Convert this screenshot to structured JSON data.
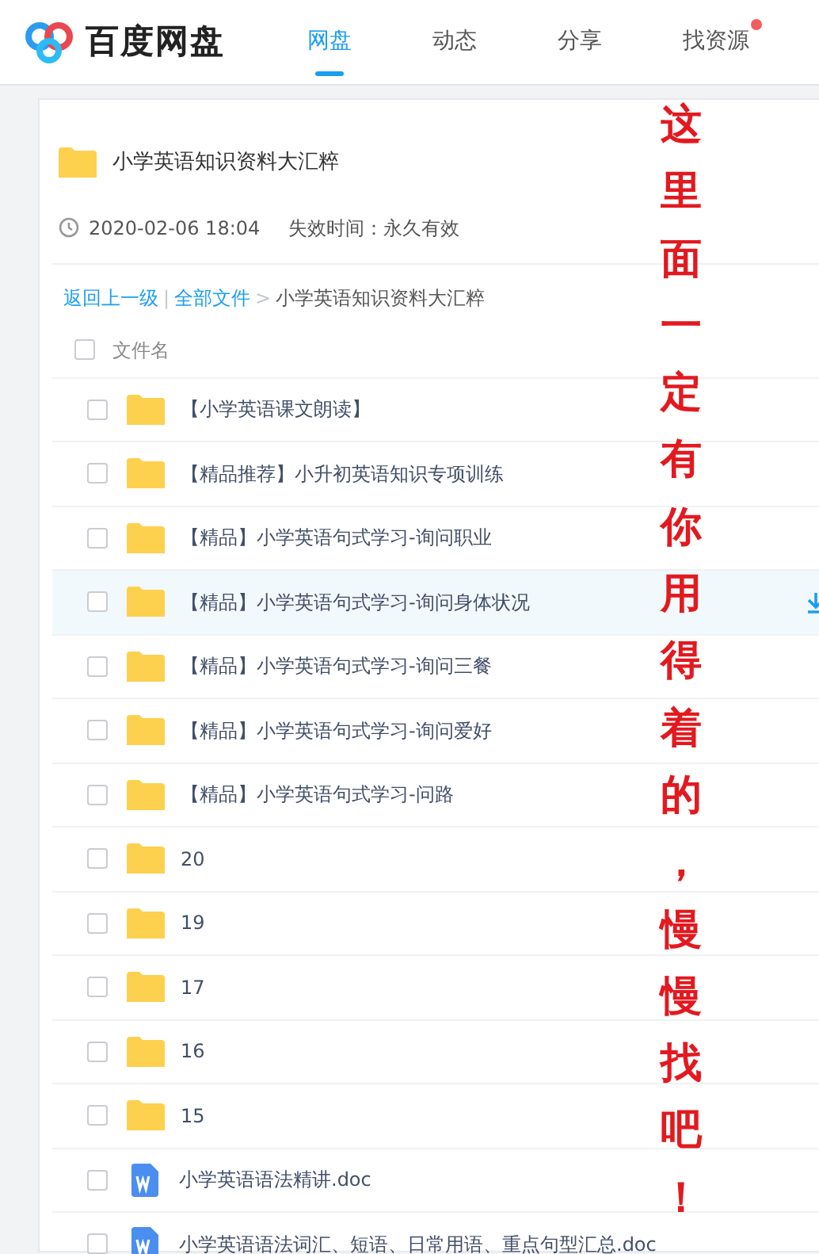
{
  "header": {
    "logo": "百度网盘",
    "tabs": [
      {
        "label": "网盘",
        "selected": true,
        "dot": false
      },
      {
        "label": "动态",
        "selected": false,
        "dot": false
      },
      {
        "label": "分享",
        "selected": false,
        "dot": false
      },
      {
        "label": "找资源",
        "selected": false,
        "dot": true
      }
    ]
  },
  "share": {
    "title": "小学英语知识资料大汇粹",
    "date": "2020-02-06 18:04",
    "expiry": "失效时间：永久有效"
  },
  "breadcrumb": {
    "back": "返回上一级",
    "separator": "|",
    "root": "全部文件",
    "arrow": ">",
    "current": "小学英语知识资料大汇粹"
  },
  "table": {
    "column": "文件名",
    "all_checked": false,
    "rows": [
      {
        "kind": "folder",
        "name": "【小学英语课文朗读】",
        "checked": false,
        "selected": false
      },
      {
        "kind": "folder",
        "name": "【精品推荐】小升初英语知识专项训练",
        "checked": false,
        "selected": false
      },
      {
        "kind": "folder",
        "name": "【精品】小学英语句式学习-询问职业",
        "checked": false,
        "selected": false
      },
      {
        "kind": "folder",
        "name": "【精品】小学英语句式学习-询问身体状况",
        "checked": false,
        "selected": true
      },
      {
        "kind": "folder",
        "name": "【精品】小学英语句式学习-询问三餐",
        "checked": false,
        "selected": false
      },
      {
        "kind": "folder",
        "name": "【精品】小学英语句式学习-询问爱好",
        "checked": false,
        "selected": false
      },
      {
        "kind": "folder",
        "name": "【精品】小学英语句式学习-问路",
        "checked": false,
        "selected": false
      },
      {
        "kind": "folder",
        "name": "20",
        "checked": false,
        "selected": false
      },
      {
        "kind": "folder",
        "name": "19",
        "checked": false,
        "selected": false
      },
      {
        "kind": "folder",
        "name": "17",
        "checked": false,
        "selected": false
      },
      {
        "kind": "folder",
        "name": "16",
        "checked": false,
        "selected": false
      },
      {
        "kind": "folder",
        "name": "15",
        "checked": false,
        "selected": false
      },
      {
        "kind": "doc",
        "name": "小学英语语法精讲.doc",
        "checked": false,
        "selected": false
      },
      {
        "kind": "doc",
        "name": "小学英语语法词汇、短语、日常用语、重点句型汇总.doc",
        "checked": false,
        "selected": false
      }
    ]
  },
  "overlay": {
    "text": "这里面一定有你用得着的，慢慢找吧！"
  }
}
